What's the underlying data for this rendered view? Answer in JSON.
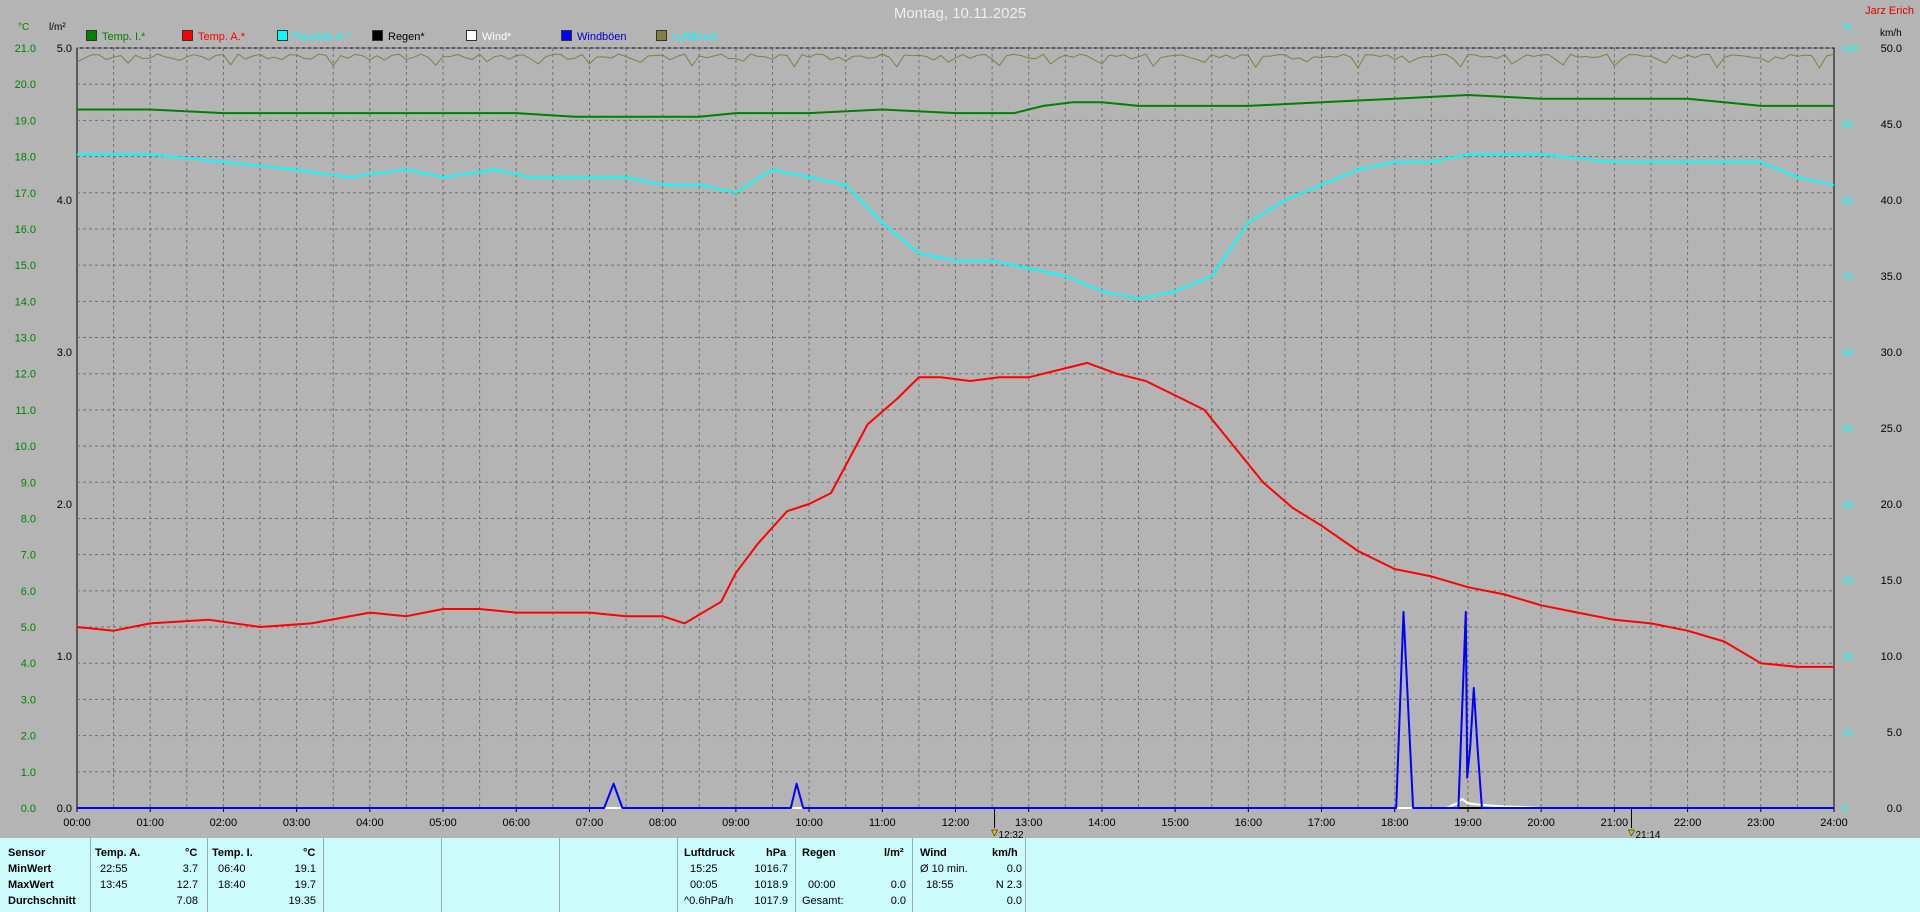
{
  "title": "Montag, 10.11.2025",
  "author": "Jarz Erich",
  "axis_units": {
    "temp": "°C",
    "rain": "l/m²",
    "humidity": "%",
    "wind": "km/h"
  },
  "legend": [
    {
      "label": "Temp. I.*",
      "color": "#008000",
      "text_color": "#008000"
    },
    {
      "label": "Temp. A.*",
      "color": "#ff0000",
      "text_color": "#ff0000"
    },
    {
      "label": "Feuchte A.*",
      "color": "#00ffff",
      "text_color": "#00ffff"
    },
    {
      "label": "Regen*",
      "color": "#000000",
      "text_color": "#000000"
    },
    {
      "label": "Wind*",
      "color": "#ffffff",
      "text_color": "#ffffff"
    },
    {
      "label": "Windböen",
      "color": "#0000ff",
      "text_color": "#0000cc"
    },
    {
      "label": "Luftdruck",
      "color": "#808040",
      "text_color": "#00ffff"
    }
  ],
  "chart_data": {
    "type": "line",
    "title": "Montag, 10.11.2025",
    "x_ticks": [
      "00:00",
      "01:00",
      "02:00",
      "03:00",
      "04:00",
      "05:00",
      "06:00",
      "07:00",
      "08:00",
      "09:00",
      "10:00",
      "11:00",
      "12:00",
      "13:00",
      "14:00",
      "15:00",
      "16:00",
      "17:00",
      "18:00",
      "19:00",
      "20:00",
      "21:00",
      "22:00",
      "23:00",
      "24:00"
    ],
    "temp_ticks": [
      "0.0",
      "1.0",
      "2.0",
      "3.0",
      "4.0",
      "5.0",
      "6.0",
      "7.0",
      "8.0",
      "9.0",
      "10.0",
      "11.0",
      "12.0",
      "13.0",
      "14.0",
      "15.0",
      "16.0",
      "17.0",
      "18.0",
      "19.0",
      "20.0",
      "21.0"
    ],
    "rain_ticks": [
      "1.0",
      "2.0",
      "3.0",
      "4.0",
      "5.0"
    ],
    "wind_ticks": [
      "0.0",
      "5.0",
      "10.0",
      "15.0",
      "20.0",
      "25.0",
      "30.0",
      "35.0",
      "40.0",
      "45.0",
      "50.0"
    ],
    "humidity_ticks": [
      "0",
      "10",
      "20",
      "30",
      "40",
      "50",
      "60",
      "70",
      "80",
      "90",
      "100"
    ],
    "temp_range": [
      0,
      21
    ],
    "wind_range": [
      0,
      50
    ],
    "humidity_range": [
      0,
      100
    ],
    "grid": true,
    "markers": [
      {
        "time": "12:32",
        "label": "12:32"
      },
      {
        "time": "21:14",
        "label": "21:14"
      }
    ],
    "series": [
      {
        "name": "Temp. I.*",
        "color": "#008000",
        "axis": "temp",
        "x": [
          0,
          1,
          2,
          3,
          4,
          5,
          6,
          6.8,
          7.5,
          8,
          8.5,
          9,
          10,
          11,
          12,
          12.8,
          13.2,
          13.6,
          14,
          14.5,
          15,
          16,
          17,
          18,
          19,
          20,
          21,
          22,
          22.5,
          23,
          24
        ],
        "y": [
          19.3,
          19.3,
          19.2,
          19.2,
          19.2,
          19.2,
          19.2,
          19.1,
          19.1,
          19.1,
          19.1,
          19.2,
          19.2,
          19.3,
          19.2,
          19.2,
          19.4,
          19.5,
          19.5,
          19.4,
          19.4,
          19.4,
          19.5,
          19.6,
          19.7,
          19.6,
          19.6,
          19.6,
          19.5,
          19.4,
          19.4
        ]
      },
      {
        "name": "Temp. A.*",
        "color": "#ff0000",
        "axis": "temp",
        "x": [
          0,
          0.5,
          1,
          1.8,
          2.5,
          3.2,
          4,
          4.5,
          5,
          5.5,
          6,
          6.5,
          7,
          7.5,
          8,
          8.3,
          8.8,
          9,
          9.3,
          9.7,
          10,
          10.3,
          10.8,
          11.2,
          11.5,
          11.8,
          12.2,
          12.6,
          13,
          13.4,
          13.8,
          14.2,
          14.6,
          15,
          15.4,
          15.8,
          16.2,
          16.6,
          17,
          17.5,
          18,
          18.5,
          19,
          19.5,
          20,
          20.5,
          21,
          21.5,
          22,
          22.5,
          23,
          23.5,
          24
        ],
        "y": [
          5.0,
          4.9,
          5.1,
          5.2,
          5.0,
          5.1,
          5.4,
          5.3,
          5.5,
          5.5,
          5.4,
          5.4,
          5.4,
          5.3,
          5.3,
          5.1,
          5.7,
          6.5,
          7.3,
          8.2,
          8.4,
          8.7,
          10.6,
          11.3,
          11.9,
          11.9,
          11.8,
          11.9,
          11.9,
          12.1,
          12.3,
          12.0,
          11.8,
          11.4,
          11.0,
          10.0,
          9.0,
          8.3,
          7.8,
          7.1,
          6.6,
          6.4,
          6.1,
          5.9,
          5.6,
          5.4,
          5.2,
          5.1,
          4.9,
          4.6,
          4.0,
          3.9,
          3.9
        ]
      },
      {
        "name": "Feuchte A.*",
        "color": "#00ffff",
        "axis": "humidity",
        "x": [
          0,
          1,
          2,
          3,
          3.7,
          4.5,
          5,
          5.7,
          6.2,
          7,
          7.5,
          8,
          8.5,
          9,
          9.5,
          10,
          10.5,
          11,
          11.5,
          12,
          12.5,
          13,
          13.5,
          14,
          14.5,
          15,
          15.5,
          16,
          16.5,
          17,
          17.5,
          18,
          18.5,
          19,
          20,
          21,
          22,
          22.5,
          23,
          23.5,
          24
        ],
        "y": [
          86,
          86,
          85,
          84,
          83,
          84,
          83,
          84,
          83,
          83,
          83,
          82,
          82,
          81,
          84,
          83,
          82,
          77,
          73,
          72,
          72,
          71,
          70,
          68,
          67,
          68,
          70,
          77,
          80,
          82,
          84,
          85,
          85,
          86,
          86,
          85,
          85,
          85,
          85,
          83,
          82
        ]
      },
      {
        "name": "Regen*",
        "color": "#000000",
        "axis": "rain",
        "x": [
          0,
          24
        ],
        "y": [
          0,
          0
        ]
      },
      {
        "name": "Wind*",
        "color": "#ffffff",
        "axis": "wind",
        "x": [
          0,
          18.7,
          18.85,
          18.92,
          19.0,
          19.2,
          19.5,
          19.8,
          20,
          24
        ],
        "y": [
          0,
          0,
          0.3,
          0.6,
          0.3,
          0.2,
          0.1,
          0.05,
          0,
          0
        ]
      },
      {
        "name": "Windböen",
        "color": "#0000ff",
        "axis": "wind",
        "x": [
          0,
          7.2,
          7.33,
          7.45,
          9.75,
          9.83,
          9.92,
          18.02,
          18.12,
          18.25,
          18.87,
          18.97,
          18.99,
          19.03,
          19.08,
          19.13,
          19.19,
          24
        ],
        "y": [
          0,
          0,
          1.6,
          0,
          0,
          1.6,
          0,
          0,
          12.9,
          0,
          0,
          12.9,
          2,
          4,
          7.9,
          4,
          0,
          0
        ]
      },
      {
        "name": "Luftdruck",
        "color": "#808040",
        "axis": "pressure",
        "x": [
          0,
          24
        ],
        "y": [
          1017.5,
          1017.5
        ]
      }
    ]
  },
  "summary": {
    "sensor_header": "Sensor",
    "row_labels": [
      "MinWert",
      "MaxWert",
      "Durchschnitt"
    ],
    "temp_a": {
      "label": "Temp. A.",
      "unit": "°C",
      "min_time": "22:55",
      "min": "3.7",
      "max_time": "13:45",
      "max": "12.7",
      "avg": "7.08"
    },
    "temp_i": {
      "label": "Temp. I.",
      "unit": "°C",
      "min_time": "06:40",
      "min": "19.1",
      "max_time": "18:40",
      "max": "19.7",
      "avg": "19.35"
    },
    "pressure": {
      "label": "Luftdruck",
      "unit": "hPa",
      "min_time": "15:25",
      "min": "1016.7",
      "max_time": "00:05",
      "max": "1018.9",
      "trend_label": "^0.6hPa/h",
      "trend_val": "1017.9"
    },
    "rain": {
      "label": "Regen",
      "unit": "l/m²",
      "max_time": "00:00",
      "max": "0.0",
      "total_label": "Gesamt:",
      "total": "0.0"
    },
    "wind": {
      "label": "Wind",
      "unit": "km/h",
      "avg_label": "Ø 10 min.",
      "avg": "0.0",
      "max_time": "18:55",
      "max": "N 2.3",
      "avg2": "0.0"
    }
  }
}
